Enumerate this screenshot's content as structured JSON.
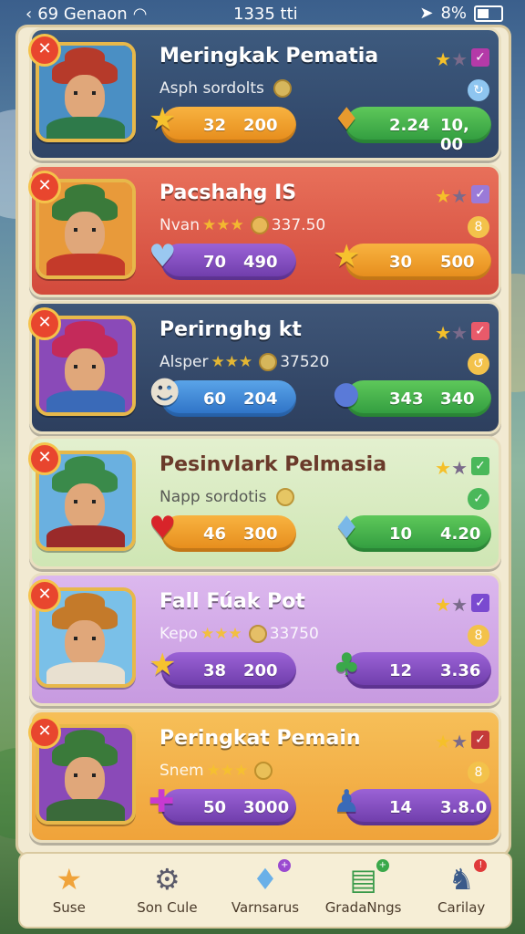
{
  "status_bar": {
    "carrier": "69 Genaon",
    "time": "1335 tti",
    "battery": "8%"
  },
  "cards": [
    {
      "name": "Meringkak Pematia",
      "subtitle": "Asph sordolts",
      "sub_stars": 0,
      "sub_value": "",
      "theme": "#2f4466",
      "theme2": "#3d5a7e",
      "check_color": "#b43aa8",
      "small_icon": "↻",
      "small_icon_color": "#8ec5f0",
      "pill1": {
        "icon": "★",
        "icon_color": "#f6c22e",
        "left": "32",
        "right": "200",
        "color": "orange"
      },
      "pill2": {
        "icon": "♦",
        "icon_color": "#e89a2e",
        "left": "2.24",
        "right": "10, 00",
        "color": "green"
      },
      "portrait_bg": "#4a8fc4",
      "hat": "#b63a2a",
      "shirt": "#2e7a4a"
    },
    {
      "name": "Pacshahg IS",
      "subtitle": "Nvan",
      "sub_stars": 3,
      "sub_value": "337.50",
      "theme": "#d24a3c",
      "theme2": "#e8705a",
      "check_color": "#9a7ad8",
      "small_icon": "8",
      "small_icon_color": "#f3c24b",
      "pill1": {
        "icon": "♥",
        "icon_color": "#9ac8f0",
        "left": "70",
        "right": "490",
        "color": "purple"
      },
      "pill2": {
        "icon": "★",
        "icon_color": "#f6c22e",
        "left": "30",
        "right": "500",
        "color": "orange"
      },
      "portrait_bg": "#e89a3a",
      "hat": "#3a7a3a",
      "shirt": "#c43a2a"
    },
    {
      "name": "Perirnghg kt",
      "subtitle": "Alsper",
      "sub_stars": 3,
      "sub_value": "37520",
      "theme": "#2d3f5e",
      "theme2": "#3f5678",
      "check_color": "#e85a6a",
      "small_icon": "↺",
      "small_icon_color": "#f3c24b",
      "pill1": {
        "icon": "☻",
        "icon_color": "#e8e0d0",
        "left": "60",
        "right": "204",
        "color": "blue"
      },
      "pill2": {
        "icon": "●",
        "icon_color": "#5a7ad8",
        "left": "343",
        "right": "340",
        "color": "green"
      },
      "portrait_bg": "#8a4ab8",
      "hat": "#c42a5a",
      "shirt": "#3a6ab8"
    },
    {
      "name": "Pesinvlark Pelmasia",
      "subtitle": "Napp sordotis",
      "sub_stars": 0,
      "sub_value": "",
      "theme": "#cfe6b4",
      "theme2": "#e3f0cf",
      "check_color": "#4ab85a",
      "small_icon": "✓",
      "small_icon_color": "#4ab85a",
      "pill1": {
        "icon": "♥",
        "icon_color": "#d8242a",
        "left": "46",
        "right": "300",
        "color": "orange"
      },
      "pill2": {
        "icon": "♦",
        "icon_color": "#7ab8e8",
        "left": "10",
        "right": "4.20",
        "color": "green"
      },
      "portrait_bg": "#6ab0e0",
      "hat": "#3a8a4a",
      "shirt": "#9a2a2a"
    },
    {
      "name": "Fall Fúak Pot",
      "subtitle": "Kepo",
      "sub_stars": 3,
      "sub_value": "33750",
      "theme": "#c79ae0",
      "theme2": "#dcb8ee",
      "check_color": "#7a4ad0",
      "small_icon": "8",
      "small_icon_color": "#f3c24b",
      "pill1": {
        "icon": "★",
        "icon_color": "#f6c22e",
        "left": "38",
        "right": "200",
        "color": "purple"
      },
      "pill2": {
        "icon": "♣",
        "icon_color": "#3aa84a",
        "left": "12",
        "right": "3.36",
        "color": "purple"
      },
      "portrait_bg": "#7ac0e8",
      "hat": "#c47a2a",
      "shirt": "#e8e0d0"
    },
    {
      "name": "Peringkat Pemain",
      "subtitle": "Snem",
      "sub_stars": 3,
      "sub_value": "",
      "theme": "#f0a33a",
      "theme2": "#f6bf58",
      "check_color": "#c43a3a",
      "small_icon": "8",
      "small_icon_color": "#f3c24b",
      "pill1": {
        "icon": "✚",
        "icon_color": "#c83ad0",
        "left": "50",
        "right": "3000",
        "color": "purple"
      },
      "pill2": {
        "icon": "♟",
        "icon_color": "#3a6ab8",
        "left": "14",
        "right": "3.8.0",
        "color": "purple"
      },
      "portrait_bg": "#8a4ab8",
      "hat": "#3a7a3a",
      "shirt": "#3a6a3a"
    }
  ],
  "nav": [
    {
      "label": "Suse",
      "icon": "★",
      "icon_color": "#f0a33a",
      "badge": ""
    },
    {
      "label": "Son Cule",
      "icon": "⚙",
      "icon_color": "#5a5a6a",
      "badge": ""
    },
    {
      "label": "Varnsarus",
      "icon": "♦",
      "icon_color": "#6ab0e8",
      "badge": "+"
    },
    {
      "label": "GradaNngs",
      "icon": "▤",
      "icon_color": "#3a9a4a",
      "badge": "+"
    },
    {
      "label": "Carilay",
      "icon": "♞",
      "icon_color": "#3a5a8a",
      "badge": "!"
    }
  ]
}
